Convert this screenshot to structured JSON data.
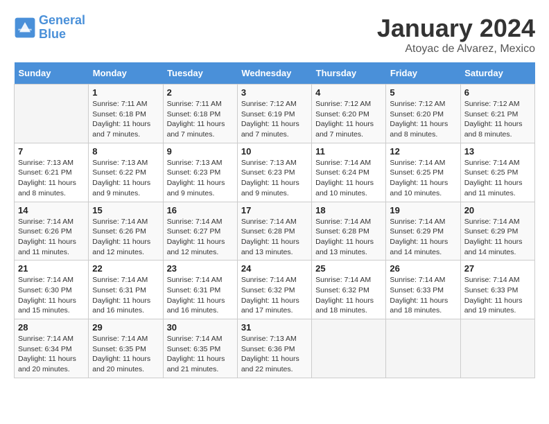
{
  "logo": {
    "line1": "General",
    "line2": "Blue"
  },
  "title": "January 2024",
  "location": "Atoyac de Alvarez, Mexico",
  "days_of_week": [
    "Sunday",
    "Monday",
    "Tuesday",
    "Wednesday",
    "Thursday",
    "Friday",
    "Saturday"
  ],
  "weeks": [
    [
      {
        "num": "",
        "sunrise": "",
        "sunset": "",
        "daylight": ""
      },
      {
        "num": "1",
        "sunrise": "Sunrise: 7:11 AM",
        "sunset": "Sunset: 6:18 PM",
        "daylight": "Daylight: 11 hours and 7 minutes."
      },
      {
        "num": "2",
        "sunrise": "Sunrise: 7:11 AM",
        "sunset": "Sunset: 6:18 PM",
        "daylight": "Daylight: 11 hours and 7 minutes."
      },
      {
        "num": "3",
        "sunrise": "Sunrise: 7:12 AM",
        "sunset": "Sunset: 6:19 PM",
        "daylight": "Daylight: 11 hours and 7 minutes."
      },
      {
        "num": "4",
        "sunrise": "Sunrise: 7:12 AM",
        "sunset": "Sunset: 6:20 PM",
        "daylight": "Daylight: 11 hours and 7 minutes."
      },
      {
        "num": "5",
        "sunrise": "Sunrise: 7:12 AM",
        "sunset": "Sunset: 6:20 PM",
        "daylight": "Daylight: 11 hours and 8 minutes."
      },
      {
        "num": "6",
        "sunrise": "Sunrise: 7:12 AM",
        "sunset": "Sunset: 6:21 PM",
        "daylight": "Daylight: 11 hours and 8 minutes."
      }
    ],
    [
      {
        "num": "7",
        "sunrise": "Sunrise: 7:13 AM",
        "sunset": "Sunset: 6:21 PM",
        "daylight": "Daylight: 11 hours and 8 minutes."
      },
      {
        "num": "8",
        "sunrise": "Sunrise: 7:13 AM",
        "sunset": "Sunset: 6:22 PM",
        "daylight": "Daylight: 11 hours and 9 minutes."
      },
      {
        "num": "9",
        "sunrise": "Sunrise: 7:13 AM",
        "sunset": "Sunset: 6:23 PM",
        "daylight": "Daylight: 11 hours and 9 minutes."
      },
      {
        "num": "10",
        "sunrise": "Sunrise: 7:13 AM",
        "sunset": "Sunset: 6:23 PM",
        "daylight": "Daylight: 11 hours and 9 minutes."
      },
      {
        "num": "11",
        "sunrise": "Sunrise: 7:14 AM",
        "sunset": "Sunset: 6:24 PM",
        "daylight": "Daylight: 11 hours and 10 minutes."
      },
      {
        "num": "12",
        "sunrise": "Sunrise: 7:14 AM",
        "sunset": "Sunset: 6:25 PM",
        "daylight": "Daylight: 11 hours and 10 minutes."
      },
      {
        "num": "13",
        "sunrise": "Sunrise: 7:14 AM",
        "sunset": "Sunset: 6:25 PM",
        "daylight": "Daylight: 11 hours and 11 minutes."
      }
    ],
    [
      {
        "num": "14",
        "sunrise": "Sunrise: 7:14 AM",
        "sunset": "Sunset: 6:26 PM",
        "daylight": "Daylight: 11 hours and 11 minutes."
      },
      {
        "num": "15",
        "sunrise": "Sunrise: 7:14 AM",
        "sunset": "Sunset: 6:26 PM",
        "daylight": "Daylight: 11 hours and 12 minutes."
      },
      {
        "num": "16",
        "sunrise": "Sunrise: 7:14 AM",
        "sunset": "Sunset: 6:27 PM",
        "daylight": "Daylight: 11 hours and 12 minutes."
      },
      {
        "num": "17",
        "sunrise": "Sunrise: 7:14 AM",
        "sunset": "Sunset: 6:28 PM",
        "daylight": "Daylight: 11 hours and 13 minutes."
      },
      {
        "num": "18",
        "sunrise": "Sunrise: 7:14 AM",
        "sunset": "Sunset: 6:28 PM",
        "daylight": "Daylight: 11 hours and 13 minutes."
      },
      {
        "num": "19",
        "sunrise": "Sunrise: 7:14 AM",
        "sunset": "Sunset: 6:29 PM",
        "daylight": "Daylight: 11 hours and 14 minutes."
      },
      {
        "num": "20",
        "sunrise": "Sunrise: 7:14 AM",
        "sunset": "Sunset: 6:29 PM",
        "daylight": "Daylight: 11 hours and 14 minutes."
      }
    ],
    [
      {
        "num": "21",
        "sunrise": "Sunrise: 7:14 AM",
        "sunset": "Sunset: 6:30 PM",
        "daylight": "Daylight: 11 hours and 15 minutes."
      },
      {
        "num": "22",
        "sunrise": "Sunrise: 7:14 AM",
        "sunset": "Sunset: 6:31 PM",
        "daylight": "Daylight: 11 hours and 16 minutes."
      },
      {
        "num": "23",
        "sunrise": "Sunrise: 7:14 AM",
        "sunset": "Sunset: 6:31 PM",
        "daylight": "Daylight: 11 hours and 16 minutes."
      },
      {
        "num": "24",
        "sunrise": "Sunrise: 7:14 AM",
        "sunset": "Sunset: 6:32 PM",
        "daylight": "Daylight: 11 hours and 17 minutes."
      },
      {
        "num": "25",
        "sunrise": "Sunrise: 7:14 AM",
        "sunset": "Sunset: 6:32 PM",
        "daylight": "Daylight: 11 hours and 18 minutes."
      },
      {
        "num": "26",
        "sunrise": "Sunrise: 7:14 AM",
        "sunset": "Sunset: 6:33 PM",
        "daylight": "Daylight: 11 hours and 18 minutes."
      },
      {
        "num": "27",
        "sunrise": "Sunrise: 7:14 AM",
        "sunset": "Sunset: 6:33 PM",
        "daylight": "Daylight: 11 hours and 19 minutes."
      }
    ],
    [
      {
        "num": "28",
        "sunrise": "Sunrise: 7:14 AM",
        "sunset": "Sunset: 6:34 PM",
        "daylight": "Daylight: 11 hours and 20 minutes."
      },
      {
        "num": "29",
        "sunrise": "Sunrise: 7:14 AM",
        "sunset": "Sunset: 6:35 PM",
        "daylight": "Daylight: 11 hours and 20 minutes."
      },
      {
        "num": "30",
        "sunrise": "Sunrise: 7:14 AM",
        "sunset": "Sunset: 6:35 PM",
        "daylight": "Daylight: 11 hours and 21 minutes."
      },
      {
        "num": "31",
        "sunrise": "Sunrise: 7:13 AM",
        "sunset": "Sunset: 6:36 PM",
        "daylight": "Daylight: 11 hours and 22 minutes."
      },
      {
        "num": "",
        "sunrise": "",
        "sunset": "",
        "daylight": ""
      },
      {
        "num": "",
        "sunrise": "",
        "sunset": "",
        "daylight": ""
      },
      {
        "num": "",
        "sunrise": "",
        "sunset": "",
        "daylight": ""
      }
    ]
  ]
}
